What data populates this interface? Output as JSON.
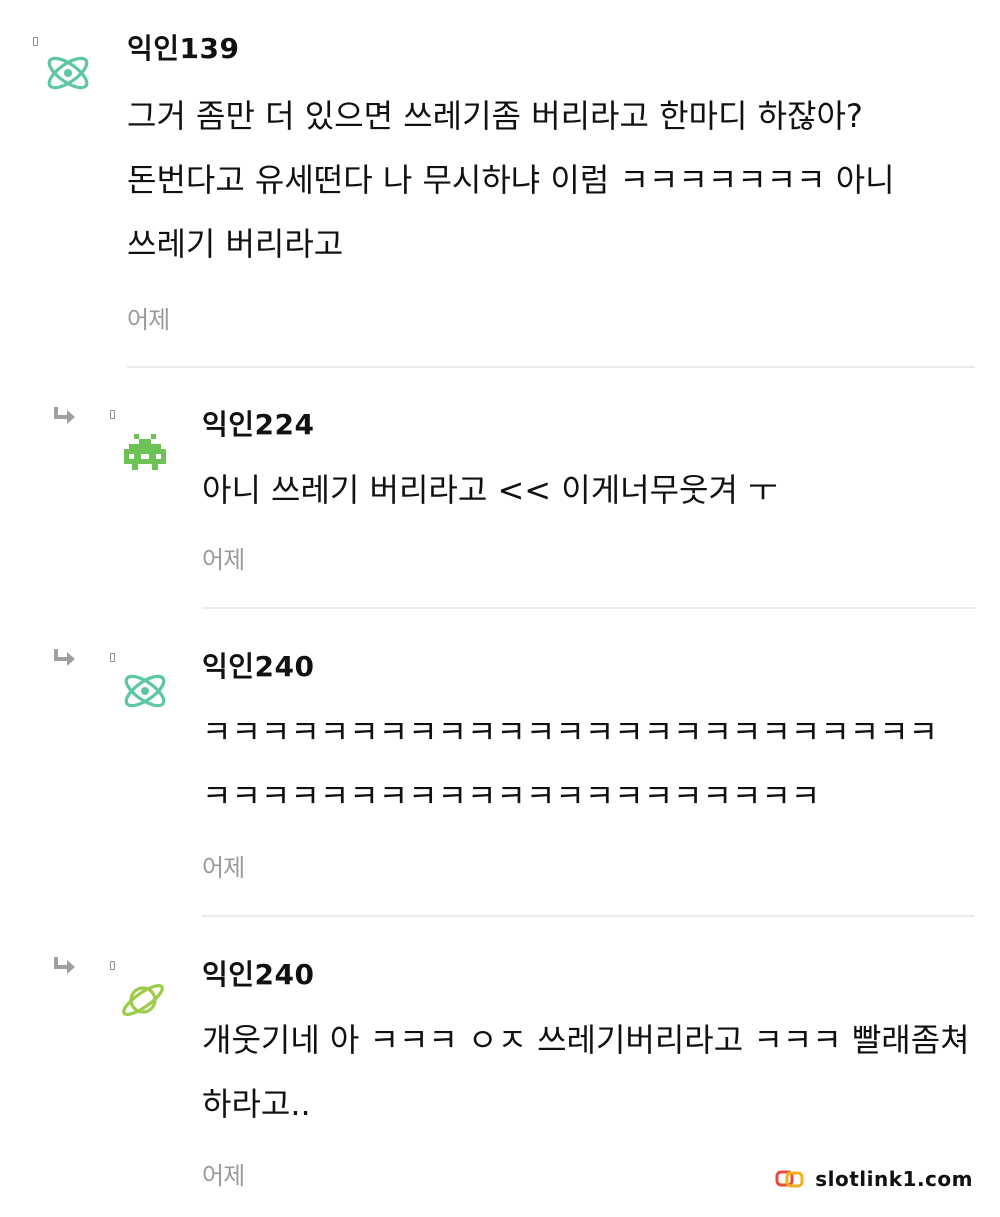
{
  "comments": [
    {
      "nickname": "익인139",
      "avatar_icon": "atom-icon",
      "avatar_color": "#5cc7a0",
      "content": "그거 좀만 더 있으면 쓰레기좀 버리라고 한마디 하잖아? 돈번다고 유세떤다 나 무시하냐 이럼 ㅋㅋㅋㅋㅋㅋㅋ 아니 쓰레기 버리라고",
      "time": "어제"
    },
    {
      "nickname": "익인224",
      "avatar_icon": "space-invader-icon",
      "avatar_color": "#6cc255",
      "content": "아니 쓰레기 버리라고 << 이게너무웃겨 ㅜ",
      "time": "어제"
    },
    {
      "nickname": "익인240",
      "avatar_icon": "atom-icon",
      "avatar_color": "#5cc7a0",
      "content": "ㅋㅋㅋㅋㅋㅋㅋㅋㅋㅋㅋㅋㅋㅋㅋㅋㅋㅋㅋㅋㅋㅋㅋㅋㅋㅋㅋㅋㅋㅋㅋㅋㅋㅋㅋㅋㅋㅋㅋㅋㅋㅋㅋㅋㅋㅋ",
      "time": "어제"
    },
    {
      "nickname": "익인240",
      "avatar_icon": "planet-icon",
      "avatar_color": "#9ccc4a",
      "content": "개웃기네 아 ㅋㅋㅋ ㅇㅈ 쓰레기버리라고 ㅋㅋㅋ 빨래좀쳐하라고..",
      "time": "어제"
    }
  ],
  "watermark": {
    "text": "slotlink1.com",
    "icon": "chain-link-icon",
    "colors": [
      "#e94b3c",
      "#f2b01e"
    ]
  },
  "colors": {
    "divider": "#ececec",
    "timestamp": "#9a9a9a",
    "reply_arrow": "#a0a0a0"
  }
}
